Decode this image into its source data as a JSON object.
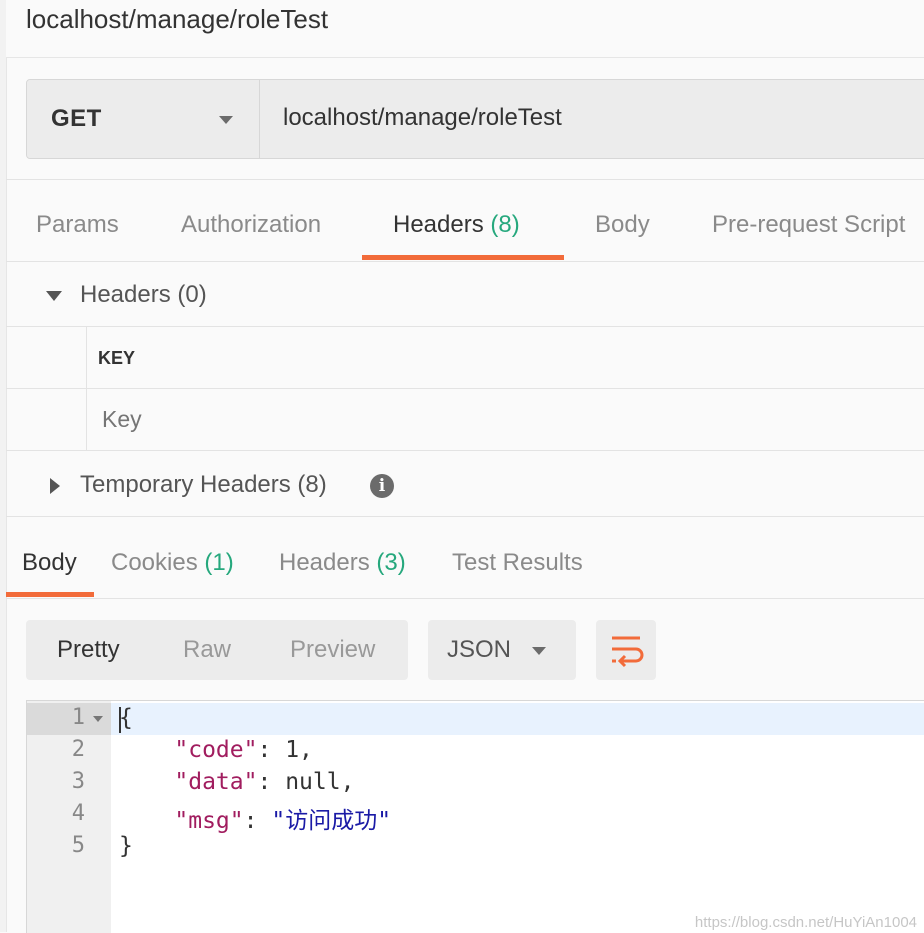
{
  "title": "localhost/manage/roleTest",
  "request": {
    "method": "GET",
    "url": "localhost/manage/roleTest"
  },
  "request_tabs": {
    "params": "Params",
    "authorization": "Authorization",
    "headers": "Headers",
    "headers_count": "(8)",
    "body": "Body",
    "pre_request": "Pre-request Script"
  },
  "headers_section": {
    "label": "Headers",
    "count": "(0)",
    "key_column": "KEY",
    "key_placeholder": "Key"
  },
  "temporary_headers": {
    "label": "Temporary Headers",
    "count": "(8)",
    "info_glyph": "i"
  },
  "response_tabs": {
    "body": "Body",
    "cookies": "Cookies",
    "cookies_count": "(1)",
    "headers": "Headers",
    "headers_count": "(3)",
    "test_results": "Test Results"
  },
  "view_modes": {
    "pretty": "Pretty",
    "raw": "Raw",
    "preview": "Preview",
    "format": "JSON"
  },
  "code_lines": {
    "numbers": [
      "1",
      "2",
      "3",
      "4",
      "5"
    ],
    "open_brace": "{",
    "key_code": "\"code\"",
    "val_code": "1",
    "key_data": "\"data\"",
    "val_data": "null",
    "key_msg": "\"msg\"",
    "val_msg": "\"访问成功\"",
    "close_brace": "}"
  },
  "watermark": "https://blog.csdn.net/HuYiAn1004",
  "colors": {
    "accent": "#f26b3a",
    "count_green": "#26a87d",
    "json_key": "#a11d5f",
    "json_string": "#1a1aa6"
  },
  "icons": {
    "method_dropdown": "chevron-down-icon",
    "format_dropdown": "chevron-down-icon",
    "wrap": "wrap-lines-icon",
    "info": "info-icon",
    "expand": "triangle-down-icon",
    "collapse": "triangle-right-icon"
  }
}
